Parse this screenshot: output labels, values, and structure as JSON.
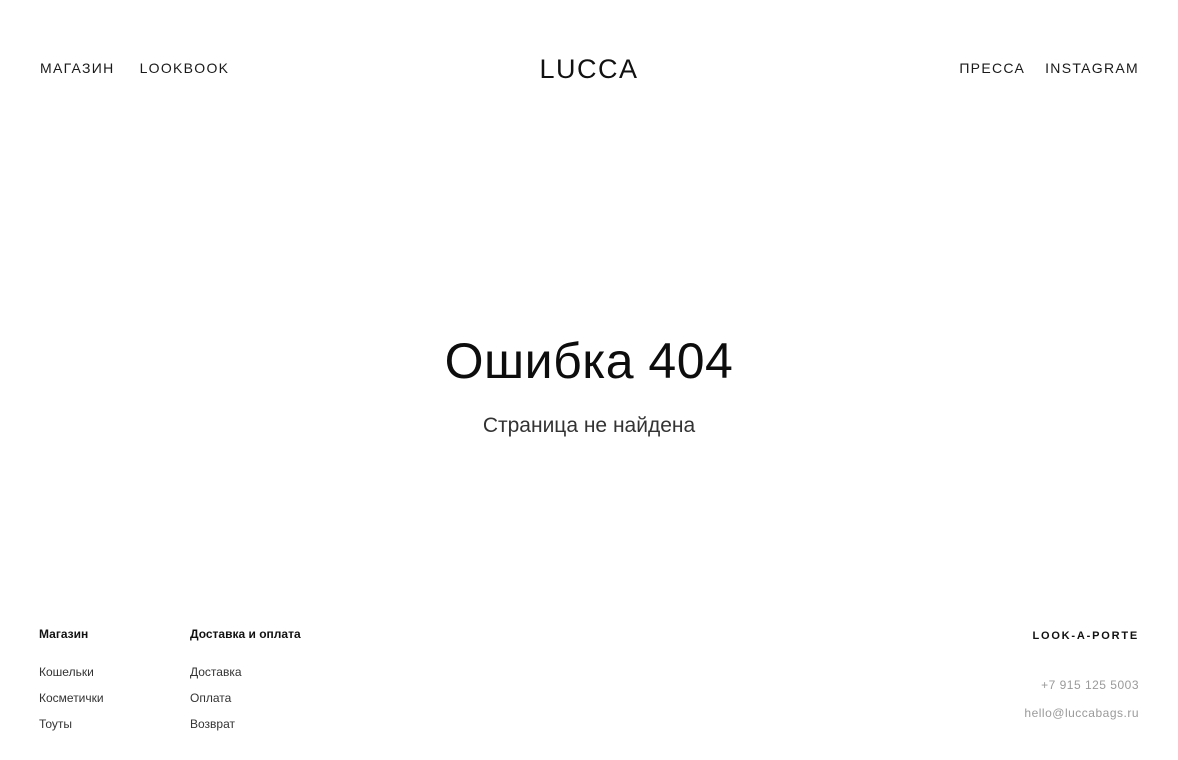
{
  "header": {
    "nav_left": [
      "МАГАЗИН",
      "LOOKBOOK"
    ],
    "logo": "LUCCA",
    "nav_right": [
      "ПРЕССА",
      "INSTAGRAM"
    ]
  },
  "main": {
    "title": "Ошибка 404",
    "subtitle": "Страница не найдена"
  },
  "footer": {
    "shop": {
      "heading": "Магазин",
      "links": [
        "Кошельки",
        "Косметички",
        "Тоуты"
      ]
    },
    "delivery": {
      "heading": "Доставка и оплата",
      "links": [
        "Доставка",
        "Оплата",
        "Возврат"
      ]
    },
    "brand": "LOOK-A-PORTE",
    "phone": "+7 915 125 5003",
    "email": "hello@luccabags.ru"
  },
  "colors": {
    "background": "#ffffff",
    "text": "#111111",
    "muted": "#9a9a9a"
  }
}
